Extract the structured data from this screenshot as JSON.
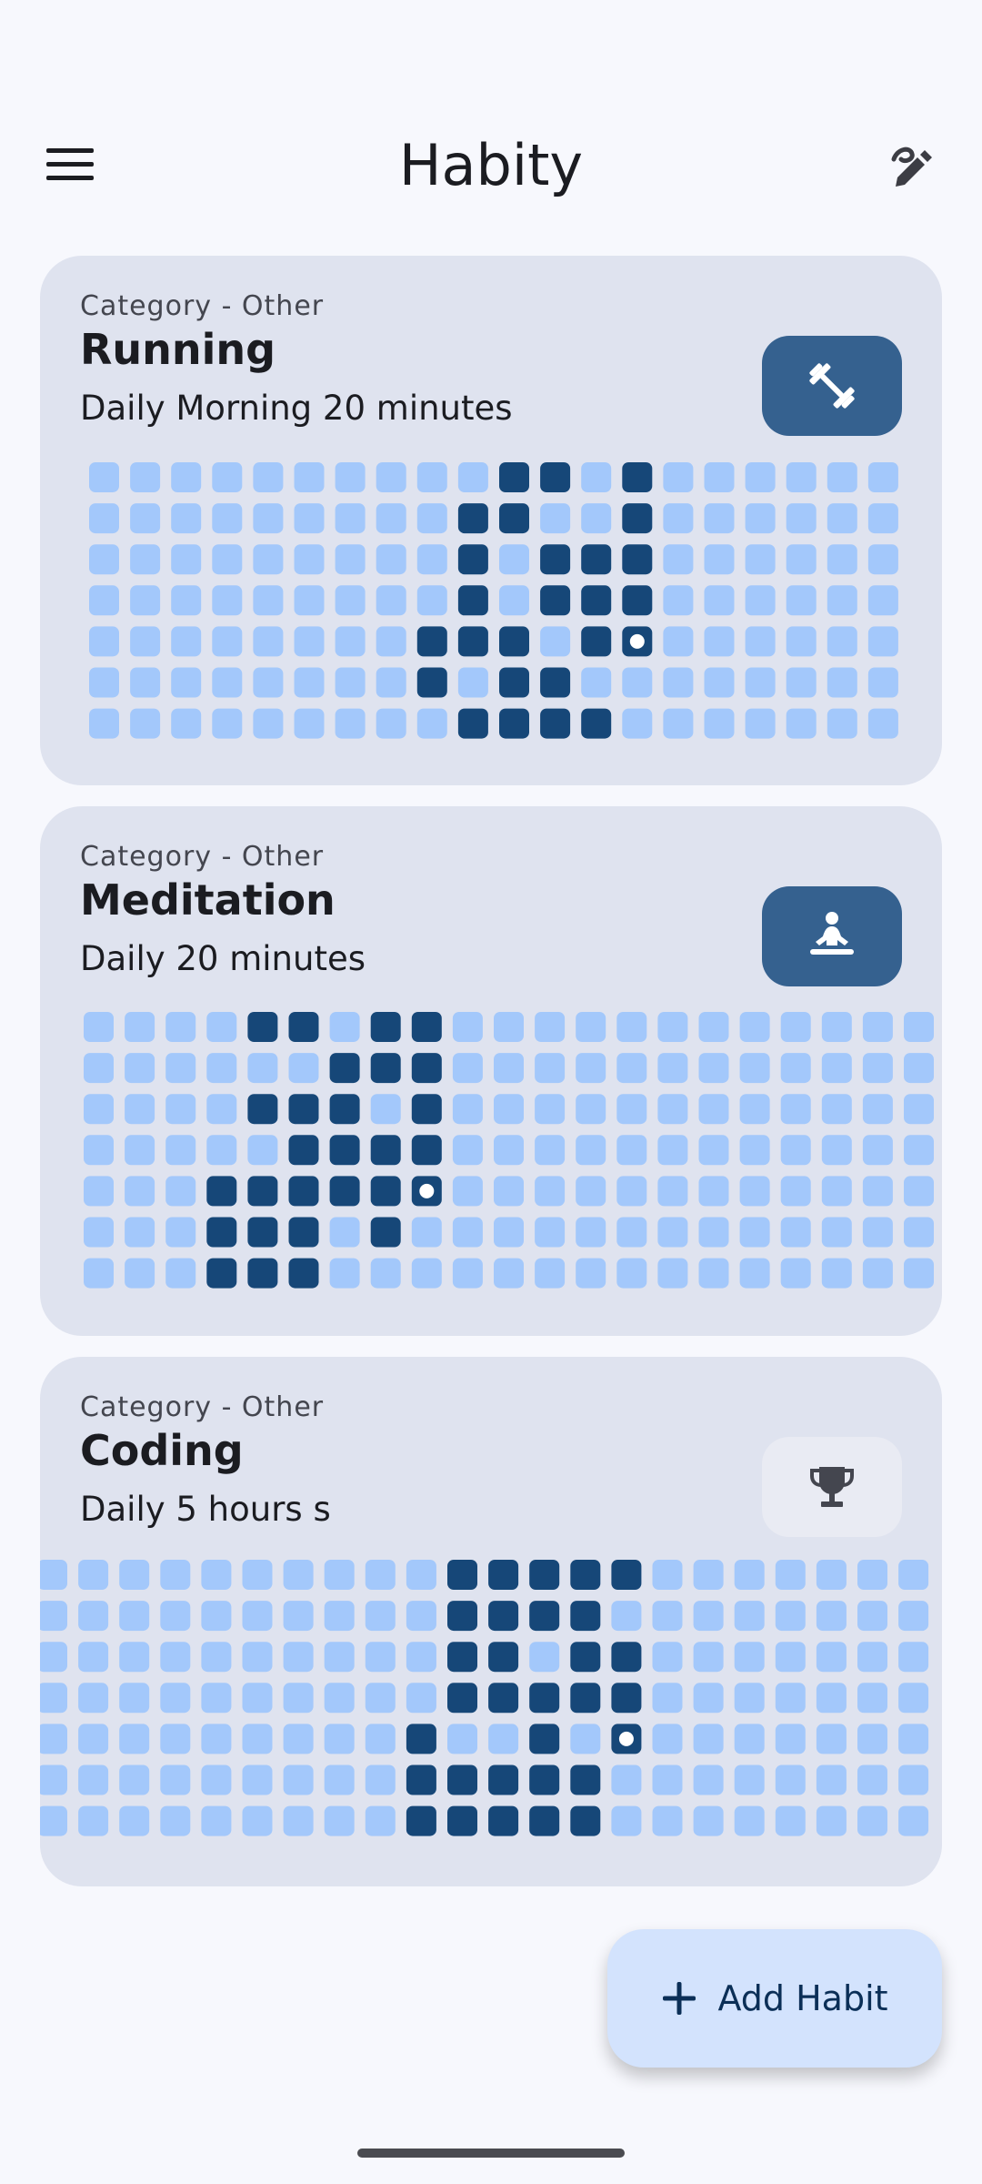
{
  "app": {
    "title": "Habity"
  },
  "topbar": {
    "menu_icon": "menu-icon",
    "edit_icon": "edit-icon"
  },
  "colors": {
    "done": "#164778",
    "empty": "#a3c8fb",
    "accent": "#35618f",
    "card": "#dfe3ef"
  },
  "habits": [
    {
      "category": "Category - Other",
      "name": "Running",
      "description": "Daily Morning 20 minutes",
      "icon": "dumbbell-icon",
      "icon_style": "filled",
      "completed": [
        [
          0,
          10
        ],
        [
          0,
          11
        ],
        [
          0,
          13
        ],
        [
          1,
          9
        ],
        [
          1,
          10
        ],
        [
          1,
          13
        ],
        [
          2,
          9
        ],
        [
          2,
          11
        ],
        [
          2,
          12
        ],
        [
          2,
          13
        ],
        [
          3,
          9
        ],
        [
          3,
          11
        ],
        [
          3,
          12
        ],
        [
          3,
          13
        ],
        [
          4,
          8
        ],
        [
          4,
          9
        ],
        [
          4,
          10
        ],
        [
          4,
          12
        ],
        [
          5,
          8
        ],
        [
          5,
          10
        ],
        [
          5,
          11
        ],
        [
          6,
          9
        ],
        [
          6,
          10
        ],
        [
          6,
          11
        ],
        [
          6,
          12
        ]
      ],
      "today": [
        4,
        13
      ]
    },
    {
      "category": "Category - Other",
      "name": "Meditation",
      "description": "Daily 20 minutes",
      "icon": "meditation-icon",
      "icon_style": "filled",
      "completed": [
        [
          0,
          4
        ],
        [
          0,
          5
        ],
        [
          0,
          7
        ],
        [
          0,
          8
        ],
        [
          1,
          6
        ],
        [
          1,
          7
        ],
        [
          1,
          8
        ],
        [
          2,
          4
        ],
        [
          2,
          5
        ],
        [
          2,
          6
        ],
        [
          2,
          8
        ],
        [
          3,
          5
        ],
        [
          3,
          6
        ],
        [
          3,
          7
        ],
        [
          3,
          8
        ],
        [
          4,
          3
        ],
        [
          4,
          4
        ],
        [
          4,
          5
        ],
        [
          4,
          6
        ],
        [
          4,
          7
        ],
        [
          5,
          3
        ],
        [
          5,
          4
        ],
        [
          5,
          5
        ],
        [
          5,
          7
        ],
        [
          6,
          3
        ],
        [
          6,
          4
        ],
        [
          6,
          5
        ]
      ],
      "today": [
        4,
        8
      ]
    },
    {
      "category": "Category - Other",
      "name": "Coding",
      "description": "Daily 5 hours s",
      "icon": "trophy-icon",
      "icon_style": "tonal",
      "completed": [
        [
          0,
          10
        ],
        [
          0,
          11
        ],
        [
          0,
          12
        ],
        [
          0,
          13
        ],
        [
          0,
          14
        ],
        [
          1,
          10
        ],
        [
          1,
          11
        ],
        [
          1,
          12
        ],
        [
          1,
          13
        ],
        [
          2,
          10
        ],
        [
          2,
          11
        ],
        [
          2,
          13
        ],
        [
          2,
          14
        ],
        [
          3,
          10
        ],
        [
          3,
          11
        ],
        [
          3,
          12
        ],
        [
          3,
          13
        ],
        [
          3,
          14
        ],
        [
          4,
          9
        ],
        [
          4,
          12
        ],
        [
          5,
          9
        ],
        [
          5,
          10
        ],
        [
          5,
          11
        ],
        [
          5,
          12
        ],
        [
          5,
          13
        ],
        [
          6,
          9
        ],
        [
          6,
          10
        ],
        [
          6,
          11
        ],
        [
          6,
          12
        ],
        [
          6,
          13
        ]
      ],
      "today": [
        4,
        14
      ]
    }
  ],
  "fab": {
    "label": "Add Habit",
    "icon": "plus-icon"
  }
}
